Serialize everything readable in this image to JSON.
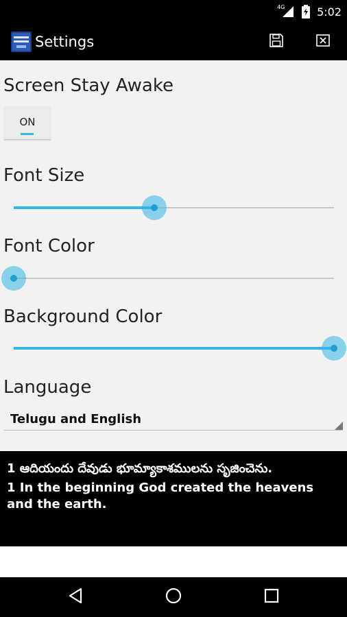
{
  "status_bar": {
    "network_label": "4G",
    "time": "5:02"
  },
  "action_bar": {
    "title": "Settings",
    "app_icon_label": "BIBLE",
    "icons": {
      "save": "save-icon",
      "close": "close-icon"
    }
  },
  "settings": {
    "screen_awake": {
      "label": "Screen Stay Awake",
      "toggle_text": "ON",
      "enabled": true
    },
    "font_size": {
      "label": "Font Size",
      "value": 0.44
    },
    "font_color": {
      "label": "Font Color",
      "value": 0.0
    },
    "background_color": {
      "label": "Background Color",
      "value": 1.0
    },
    "language": {
      "label": "Language",
      "selected": "Telugu and English"
    }
  },
  "preview": {
    "telugu_line": "1 ఆదియందు దేవుడు భూమ్యాకాశములను సృజించెను.",
    "english_line": "1 In the beginning God created the heavens and the earth."
  },
  "colors": {
    "accent": "#33b5e5",
    "bar_background": "#000000",
    "content_background": "#f2f2f2"
  },
  "nav_bar": {
    "icons": [
      "back-icon",
      "home-icon",
      "recents-icon"
    ]
  }
}
